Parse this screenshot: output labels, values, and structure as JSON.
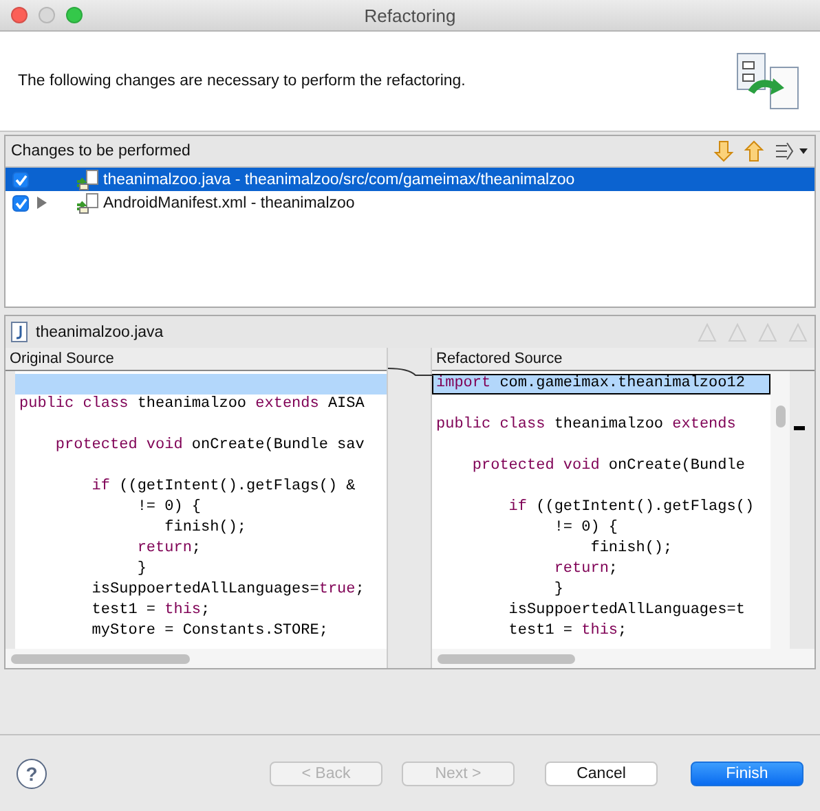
{
  "window": {
    "title": "Refactoring"
  },
  "header": {
    "message": "The following changes are necessary to perform the refactoring."
  },
  "changes": {
    "title": "Changes to be performed",
    "items": [
      {
        "label": "theanimalzoo.java - theanimalzoo/src/com/gameimax/theanimalzoo",
        "checked": true,
        "selected": true,
        "expandable": false
      },
      {
        "label": "AndroidManifest.xml - theanimalzoo",
        "checked": true,
        "selected": false,
        "expandable": true
      }
    ]
  },
  "compare": {
    "file": "theanimalzoo.java",
    "left": {
      "title": "Original Source",
      "lines": [
        {
          "highlighted": true
        },
        {
          "highlighted": false,
          "segments": [
            {
              "kind": "keyword",
              "text": "public class"
            },
            {
              "kind": "plain",
              "text": " theanimalzoo "
            },
            {
              "kind": "keyword",
              "text": "extends"
            },
            {
              "kind": "plain",
              "text": " AISA"
            }
          ]
        },
        {
          "highlighted": false
        },
        {
          "highlighted": false,
          "segments": [
            {
              "kind": "keyword",
              "text": "    protected void"
            },
            {
              "kind": "plain",
              "text": " onCreate(Bundle sav"
            }
          ]
        },
        {
          "highlighted": false
        },
        {
          "highlighted": false,
          "segments": [
            {
              "kind": "keyword",
              "text": "        if"
            },
            {
              "kind": "plain",
              "text": " ((getIntent().getFlags() &"
            }
          ]
        },
        {
          "highlighted": false,
          "segments": [
            {
              "kind": "plain",
              "text": "             != 0) {"
            }
          ]
        },
        {
          "highlighted": false,
          "segments": [
            {
              "kind": "plain",
              "text": "                finish();"
            }
          ]
        },
        {
          "highlighted": false,
          "segments": [
            {
              "kind": "keyword",
              "text": "             return"
            },
            {
              "kind": "plain",
              "text": ";"
            }
          ]
        },
        {
          "highlighted": false,
          "segments": [
            {
              "kind": "plain",
              "text": "             }"
            }
          ]
        },
        {
          "highlighted": false,
          "segments": [
            {
              "kind": "plain",
              "text": "        isSuppoertedAllLanguages="
            },
            {
              "kind": "keyword",
              "text": "true"
            },
            {
              "kind": "plain",
              "text": ";"
            }
          ]
        },
        {
          "highlighted": false,
          "segments": [
            {
              "kind": "plain",
              "text": "        test1 = "
            },
            {
              "kind": "keyword",
              "text": "this"
            },
            {
              "kind": "plain",
              "text": ";"
            }
          ]
        },
        {
          "highlighted": false,
          "segments": [
            {
              "kind": "plain",
              "text": "        myStore = Constants.STORE;"
            }
          ]
        }
      ]
    },
    "right": {
      "title": "Refactored Source",
      "lines": [
        {
          "highlighted": true,
          "segments": [
            {
              "kind": "keyword",
              "text": "import"
            },
            {
              "kind": "plain",
              "text": " com.gameimax.theanimalzoo12"
            }
          ]
        },
        {
          "highlighted": false
        },
        {
          "highlighted": false,
          "segments": [
            {
              "kind": "keyword",
              "text": "public class"
            },
            {
              "kind": "plain",
              "text": " theanimalzoo "
            },
            {
              "kind": "keyword",
              "text": "extends"
            }
          ]
        },
        {
          "highlighted": false
        },
        {
          "highlighted": false,
          "segments": [
            {
              "kind": "keyword",
              "text": "    protected void"
            },
            {
              "kind": "plain",
              "text": " onCreate(Bundle"
            }
          ]
        },
        {
          "highlighted": false
        },
        {
          "highlighted": false,
          "segments": [
            {
              "kind": "keyword",
              "text": "        if"
            },
            {
              "kind": "plain",
              "text": " ((getIntent().getFlags()"
            }
          ]
        },
        {
          "highlighted": false,
          "segments": [
            {
              "kind": "plain",
              "text": "             != 0) {"
            }
          ]
        },
        {
          "highlighted": false,
          "segments": [
            {
              "kind": "plain",
              "text": "                 finish();"
            }
          ]
        },
        {
          "highlighted": false,
          "segments": [
            {
              "kind": "keyword",
              "text": "             return"
            },
            {
              "kind": "plain",
              "text": ";"
            }
          ]
        },
        {
          "highlighted": false,
          "segments": [
            {
              "kind": "plain",
              "text": "             }"
            }
          ]
        },
        {
          "highlighted": false,
          "segments": [
            {
              "kind": "plain",
              "text": "        isSuppoertedAllLanguages=t"
            }
          ]
        },
        {
          "highlighted": false,
          "segments": [
            {
              "kind": "plain",
              "text": "        test1 = "
            },
            {
              "kind": "keyword",
              "text": "this"
            },
            {
              "kind": "plain",
              "text": ";"
            }
          ]
        }
      ]
    }
  },
  "help": {
    "label": "?"
  },
  "buttons": [
    {
      "label": "< Back",
      "kind": "secondary",
      "disabled": true
    },
    {
      "label": "Next >",
      "kind": "secondary",
      "disabled": true
    },
    {
      "label": "Cancel",
      "kind": "secondary",
      "disabled": false
    },
    {
      "label": "Finish",
      "kind": "primary",
      "disabled": false
    }
  ]
}
